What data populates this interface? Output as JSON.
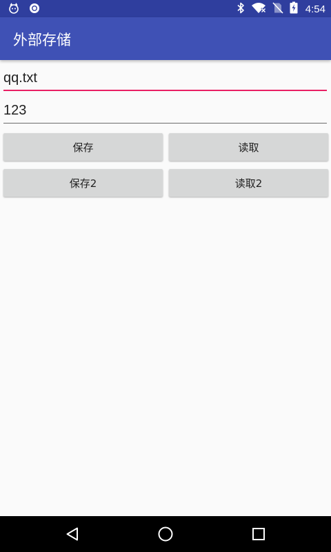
{
  "status_bar": {
    "time": "4:54",
    "icons": [
      "cat-notification-icon",
      "sync-notification-icon",
      "bluetooth-icon",
      "wifi-icon",
      "no-sim-icon",
      "battery-charging-icon"
    ],
    "background": "#2f3e9e"
  },
  "app_bar": {
    "title": "外部存储",
    "background": "#3f51b5"
  },
  "form": {
    "file_name_value": "qq.txt",
    "content_value": "123",
    "focus_underline_color": "#e91e63"
  },
  "buttons": {
    "save": "保存",
    "read": "读取",
    "save2": "保存2",
    "read2": "读取2"
  },
  "nav_bar": {
    "icons": [
      "back-icon",
      "home-icon",
      "recents-icon"
    ]
  }
}
